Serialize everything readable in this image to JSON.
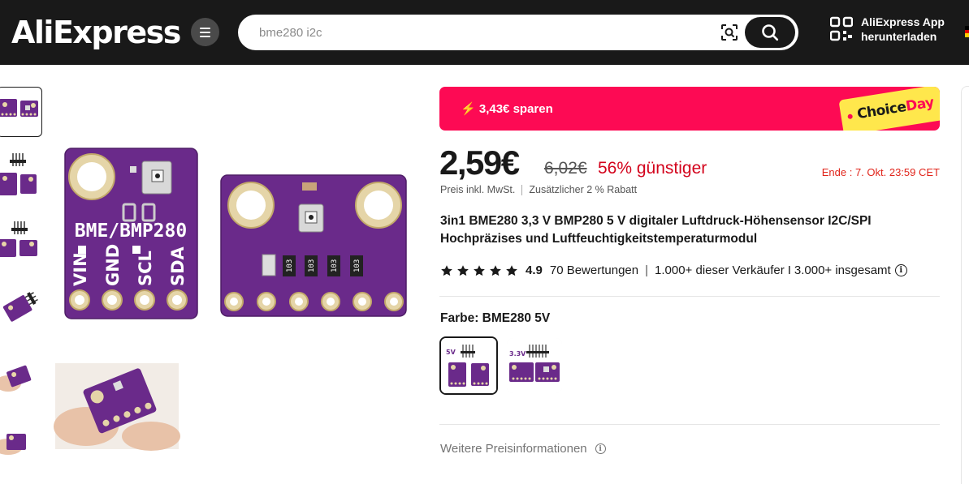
{
  "header": {
    "logo": "AliExpress",
    "search_placeholder": "bme280 i2c",
    "app_line1": "AliExpress App",
    "app_line2": "herunterladen"
  },
  "gallery": {
    "thumbnail_count": 6,
    "active_index": 0,
    "main_image_board1_title": "BME/BMP280",
    "main_image_board1_pins": [
      "VIN",
      "GND",
      "SCL",
      "SDA"
    ],
    "main_image_board2_parts": [
      "103",
      "103",
      "103",
      "103"
    ]
  },
  "promo": {
    "save_text": "3,43€ sparen",
    "choice_word1": "Choice",
    "choice_word2": "Day"
  },
  "pricing": {
    "price": "2,59€",
    "old_price": "6,02€",
    "discount": "56% günstiger",
    "ends": "Ende :  7. Okt. 23:59 CET",
    "tax_note": "Preis inkl. MwSt.",
    "extra_discount": "Zusätzlicher 2 % Rabatt"
  },
  "product": {
    "title": "3in1 BME280 3,3 V BMP280 5 V digitaler Luftdruck-Höhensensor I2C/SPI Hochpräzises und Luftfeuchtigkeitstemperaturmodul",
    "rating": 4.9,
    "rating_text": "4.9",
    "stars": 5,
    "reviews": "70 Bewertungen",
    "sold_seller": "1.000+ dieser Verkäufer",
    "sold_separator": "I",
    "sold_total": "3.000+ insgesamt"
  },
  "variants": {
    "label": "Farbe: BME280 5V",
    "options": [
      {
        "tag": "5V",
        "selected": true
      },
      {
        "tag": "3.3V",
        "selected": false
      }
    ]
  },
  "more_info": "Weitere Preisinformationen",
  "colors": {
    "header_bg": "#191919",
    "promo_red": "#fd0a54",
    "choice_yellow": "#ffe74c",
    "discount_red": "#d3031c",
    "board_purple": "#6a2a8a"
  }
}
